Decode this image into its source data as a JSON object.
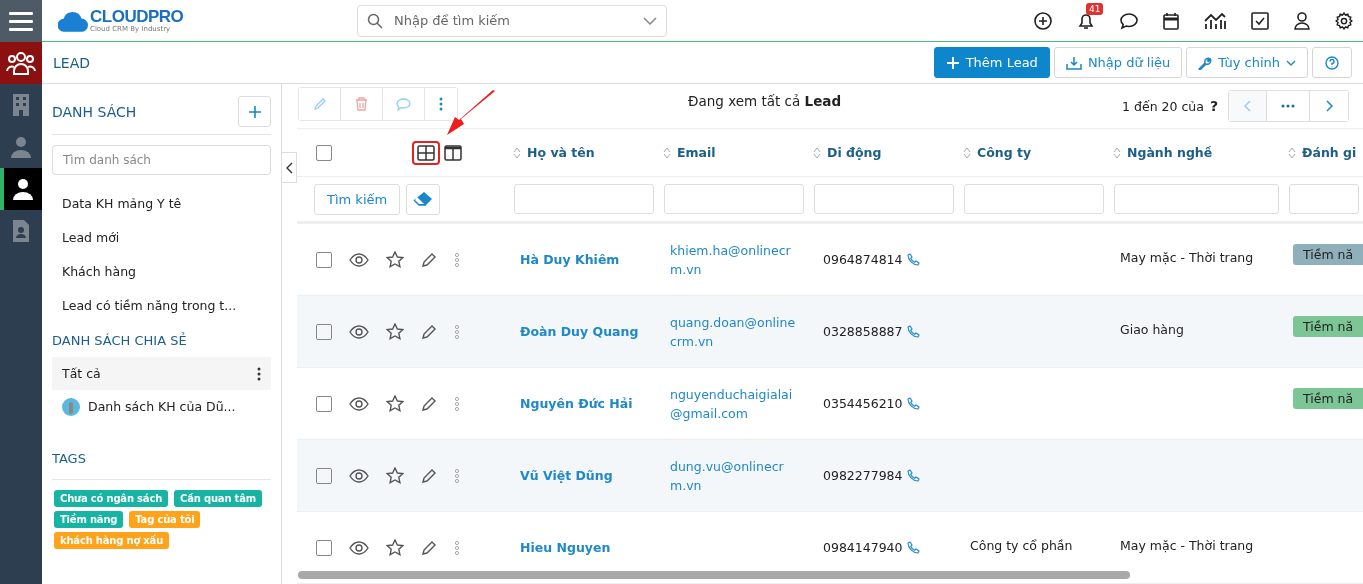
{
  "topbar": {
    "logo": "CLOUDPRO",
    "tagline": "Cloud CRM By Industry",
    "search": {
      "placeholder": "Nhập để tìm kiếm"
    },
    "notification_count": "41"
  },
  "rail": [
    {
      "kind": "people",
      "selected": false
    },
    {
      "kind": "building",
      "selected": false
    },
    {
      "kind": "contact",
      "selected": false
    },
    {
      "kind": "person",
      "selected": true
    },
    {
      "kind": "card",
      "selected": false
    }
  ],
  "module": {
    "title": "LEAD",
    "buttons": [
      {
        "kind": "primary",
        "label": "Thêm Lead"
      },
      {
        "kind": "import",
        "label": "Nhập dữ liệu"
      },
      {
        "kind": "customize",
        "label": "Tùy chỉnh"
      },
      {
        "kind": "help"
      }
    ]
  },
  "sidebar": {
    "title": "DANH SÁCH",
    "search": {
      "placeholder": "Tìm danh sách"
    },
    "lists": [
      {
        "label": "Data KH mảng Y tê",
        "selected": false
      },
      {
        "label": "Lead mới",
        "selected": false
      },
      {
        "label": "Khách hàng",
        "selected": false
      },
      {
        "label": "Lead có tiềm năng trong t...",
        "selected": false
      }
    ],
    "shared_title": "DANH SÁCH CHIA SẺ",
    "shared": [
      {
        "label": "Tất cả",
        "selected": true,
        "kind": "plain"
      },
      {
        "label": "Danh sách KH của Dũ...",
        "selected": false,
        "kind": "avatar"
      }
    ],
    "tags_title": "TAGS",
    "tags": [
      {
        "label": "Chưa có ngân sách",
        "color": "#17b3a3"
      },
      {
        "label": "Cần quan tâm",
        "color": "#17b3a3"
      },
      {
        "label": "Tiềm năng",
        "color": "#17b3a3"
      },
      {
        "label": "Tag của tôi",
        "color": "#ffa31a"
      },
      {
        "label": "khách hàng nợ xấu",
        "color": "#ffa31a"
      }
    ]
  },
  "toolbar": {
    "view_text": "Đang xem tất cả **Lead**",
    "pager": "1 đến 20 của",
    "pager_total": "?"
  },
  "table": {
    "select_all_checked": false,
    "columns": [
      "Họ và tên",
      "Email",
      "Di động",
      "Công ty",
      "Ngành nghề",
      "Đánh gi"
    ],
    "filter_button": "Tìm kiếm",
    "rows": [
      {
        "name": "Hà Duy Khiêm",
        "email": "khiem.ha@onlinecrm.vn",
        "phone": "0964874814",
        "industry": "May mặc - Thời trang",
        "checked": false,
        "rating": {
          "label": "Tiềm nă",
          "color": "#8fb0bb"
        }
      },
      {
        "name": "Đoàn Duy Quang",
        "email": "quang.doan@onlinecrm.vn",
        "phone": "0328858887",
        "industry": "Giao hàng",
        "checked": false,
        "rating": {
          "label": "Tiềm nă",
          "color": "#7cc594"
        }
      },
      {
        "name": "Nguyên Đức Hải",
        "email": "nguyenduchaigialai@gmail.com",
        "phone": "0354456210",
        "checked": false,
        "rating": {
          "label": "Tiềm nă",
          "color": "#7cc594"
        }
      },
      {
        "name": "Vũ Việt Dũng",
        "email": "dung.vu@onlinecrm.vn",
        "phone": "0982277984",
        "checked": false
      },
      {
        "name": "Hieu Nguyen",
        "phone": "0984147940",
        "company": "Công ty cổ phần",
        "industry": "May mặc - Thời trang",
        "checked": false
      }
    ]
  }
}
